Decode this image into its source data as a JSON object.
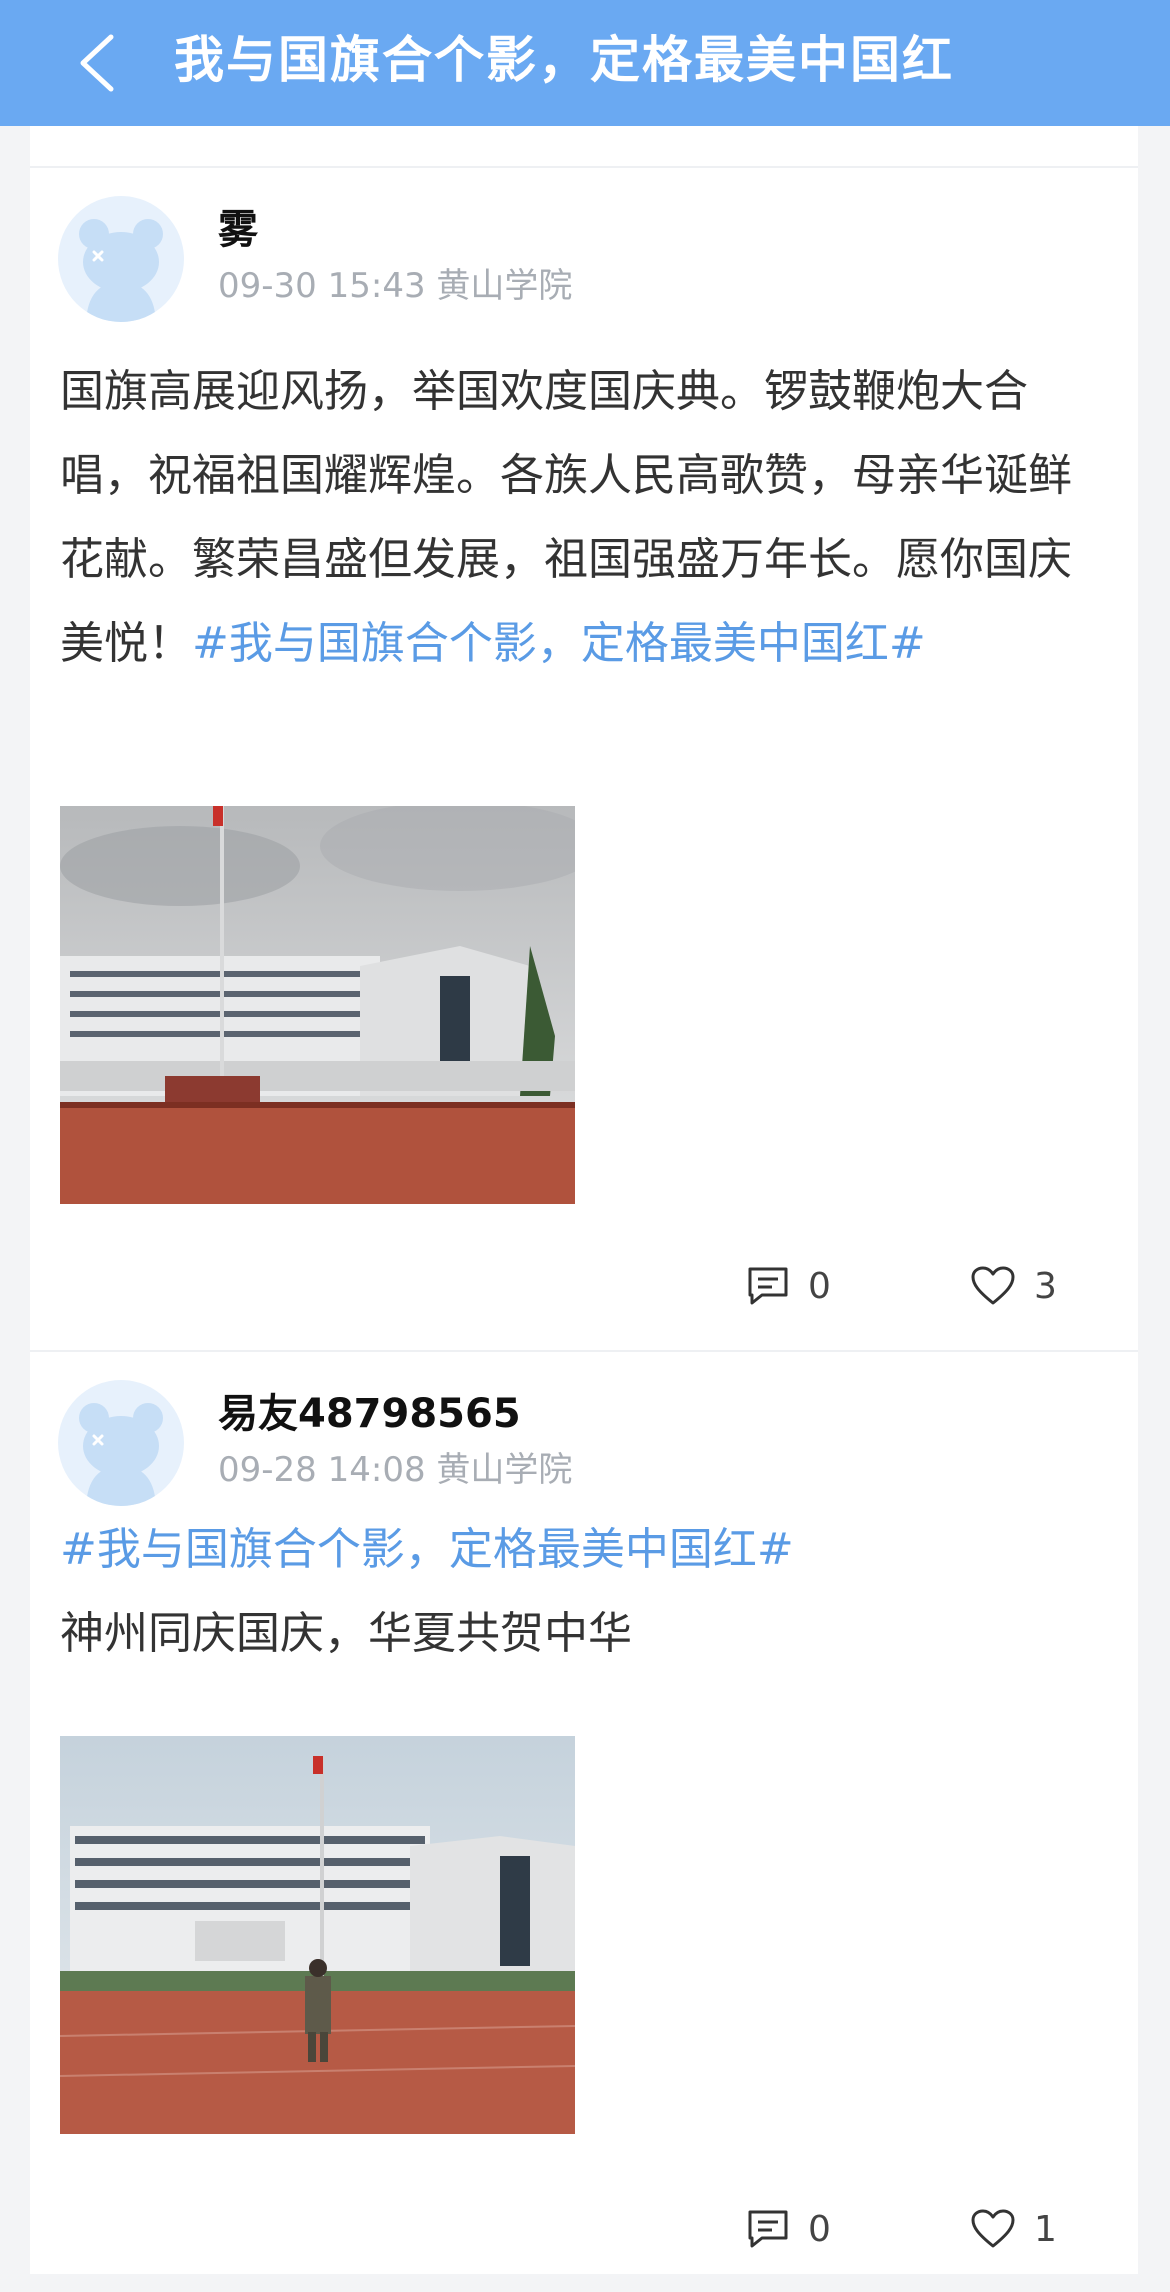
{
  "header": {
    "title": "我与国旗合个影，定格最美中国红",
    "back_icon": "chevron-left-icon"
  },
  "posts": [
    {
      "user_name": "雾",
      "time": "09-30 15:43",
      "school": "黄山学院",
      "text": "国旗高展迎风扬，举国欢度国庆典。锣鼓鞭炮大合唱，祝福祖国耀辉煌。各族人民高歌赞，母亲华诞鲜花献。繁荣昌盛但发展，祖国强盛万年长。愿你国庆美悦！",
      "hashtag": "#我与国旗合个影，定格最美中国红#",
      "comments": "0",
      "likes": "3"
    },
    {
      "user_name": "易友48798565",
      "time": "09-28 14:08",
      "school": "黄山学院",
      "hashtag": "#我与国旗合个影，定格最美中国红#",
      "text": "神州同庆国庆，华夏共贺中华",
      "comments": "0",
      "likes": "1"
    }
  ],
  "colors": {
    "header_bg": "#6aa9f2",
    "hashtag": "#5a9be5",
    "meta_text": "#a8adb4",
    "avatar_bg": "#e7f1fc"
  }
}
